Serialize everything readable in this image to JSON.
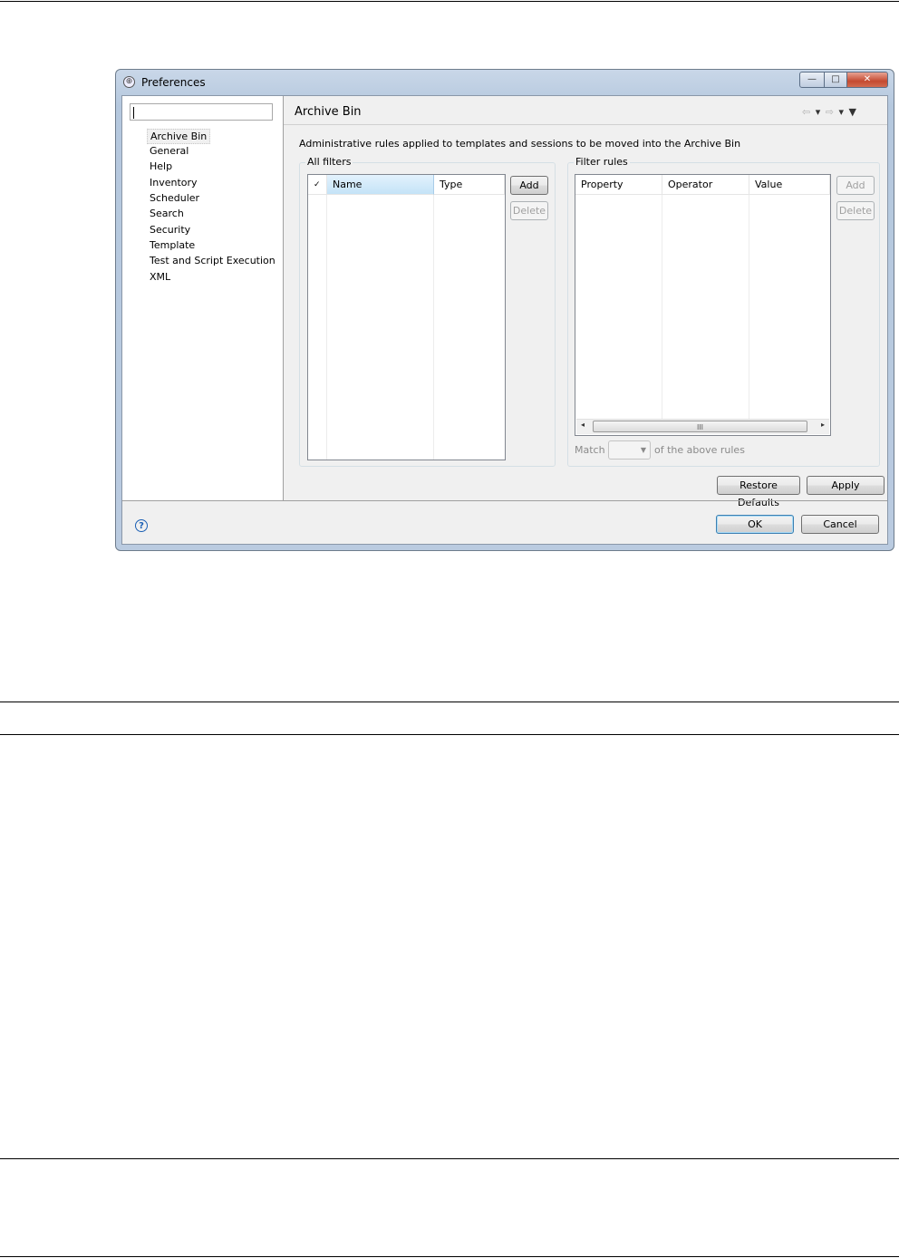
{
  "window": {
    "title": "Preferences",
    "minimize_glyph": "—",
    "maximize_glyph": "□",
    "close_glyph": "✕"
  },
  "nav": {
    "filter_value": "",
    "items": [
      {
        "label": "Archive Bin",
        "selected": true
      },
      {
        "label": "General"
      },
      {
        "label": "Help"
      },
      {
        "label": "Inventory"
      },
      {
        "label": "Scheduler"
      },
      {
        "label": "Search"
      },
      {
        "label": "Security"
      },
      {
        "label": "Template"
      },
      {
        "label": "Test and Script Execution"
      },
      {
        "label": "XML"
      }
    ]
  },
  "page": {
    "title": "Archive Bin",
    "description": "Administrative rules applied to templates and sessions to be moved into the Archive Bin",
    "nav_back_glyph": "⇦",
    "nav_fwd_glyph": "⇨",
    "dropdown_glyph": "▾",
    "menu_glyph": "▼"
  },
  "all_filters": {
    "label": "All filters",
    "columns": [
      "✓",
      "Name",
      "Type"
    ],
    "rows": [],
    "add_label": "Add",
    "delete_label": "Delete"
  },
  "filter_rules": {
    "label": "Filter rules",
    "columns": [
      "Property",
      "Operator",
      "Value"
    ],
    "rows": [],
    "add_label": "Add",
    "delete_label": "Delete",
    "match_label": "Match",
    "match_value": "",
    "match_suffix": "of the above rules",
    "scroll_thumb_glyph": "III"
  },
  "buttons": {
    "restore_defaults": "Restore Defaults",
    "apply": "Apply",
    "ok": "OK",
    "cancel": "Cancel",
    "help": "?"
  },
  "colors": {
    "selection_header": "#c4e3f7",
    "title_bar": "#b5c8de",
    "close_button": "#c44a31"
  }
}
